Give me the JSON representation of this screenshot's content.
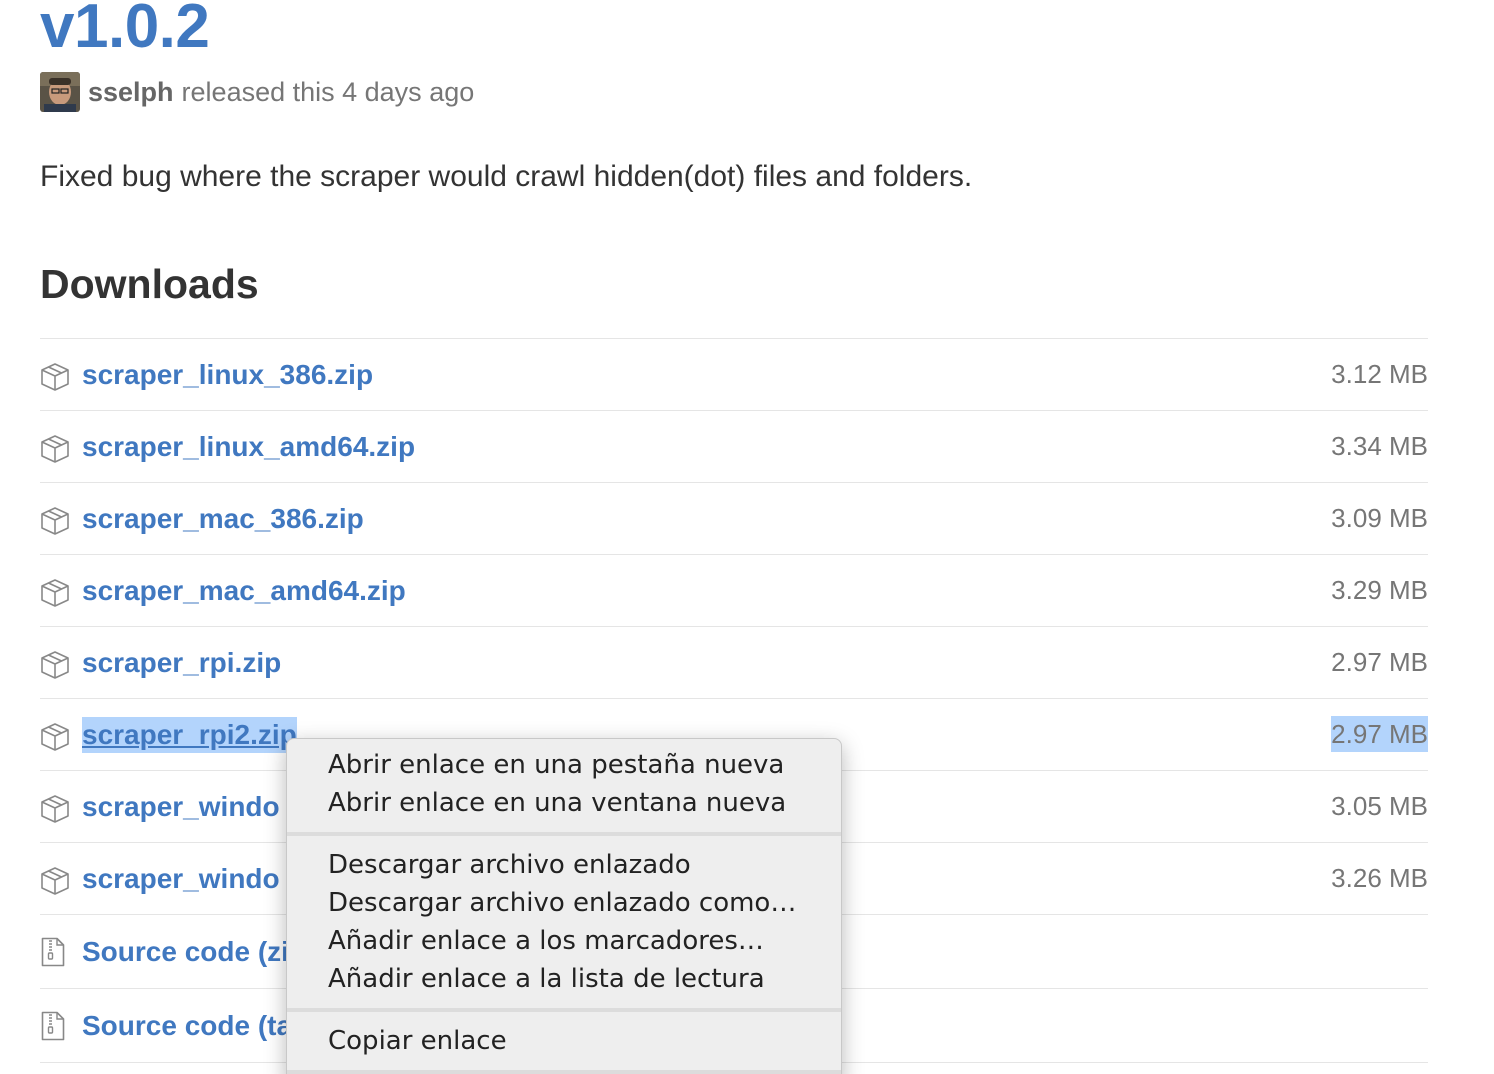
{
  "release": {
    "title": "v1.0.2",
    "author": "sselph",
    "meta_text": "released this 4 days ago",
    "body": "Fixed bug where the scraper would crawl hidden(dot) files and folders."
  },
  "downloads": {
    "heading": "Downloads",
    "assets": [
      {
        "name": "scraper_linux_386.zip",
        "size": "3.12 MB",
        "icon": "package-icon"
      },
      {
        "name": "scraper_linux_amd64.zip",
        "size": "3.34 MB",
        "icon": "package-icon"
      },
      {
        "name": "scraper_mac_386.zip",
        "size": "3.09 MB",
        "icon": "package-icon"
      },
      {
        "name": "scraper_mac_amd64.zip",
        "size": "3.29 MB",
        "icon": "package-icon"
      },
      {
        "name": "scraper_rpi.zip",
        "size": "2.97 MB",
        "icon": "package-icon"
      },
      {
        "name": "scraper_rpi2.zip",
        "size": "2.97 MB",
        "icon": "package-icon",
        "selected": true
      },
      {
        "name": "scraper_windo",
        "size": "3.05 MB",
        "icon": "package-icon"
      },
      {
        "name": "scraper_windo",
        "size": "3.26 MB",
        "icon": "package-icon"
      }
    ],
    "source": [
      {
        "name": "Source code (zi",
        "icon": "file-zip-icon"
      },
      {
        "name": "Source code (ta",
        "icon": "file-zip-icon"
      }
    ]
  },
  "context_menu": {
    "group1": [
      "Abrir enlace en una pestaña nueva",
      "Abrir enlace en una ventana nueva"
    ],
    "group2": [
      "Descargar archivo enlazado",
      "Descargar archivo enlazado como…",
      "Añadir enlace a los marcadores…",
      "Añadir enlace a la lista de lectura"
    ],
    "group3": [
      "Copiar enlace"
    ]
  },
  "colors": {
    "link": "#4078c0",
    "selection": "#b3d4fc",
    "menu_background": "#eeeeee"
  }
}
